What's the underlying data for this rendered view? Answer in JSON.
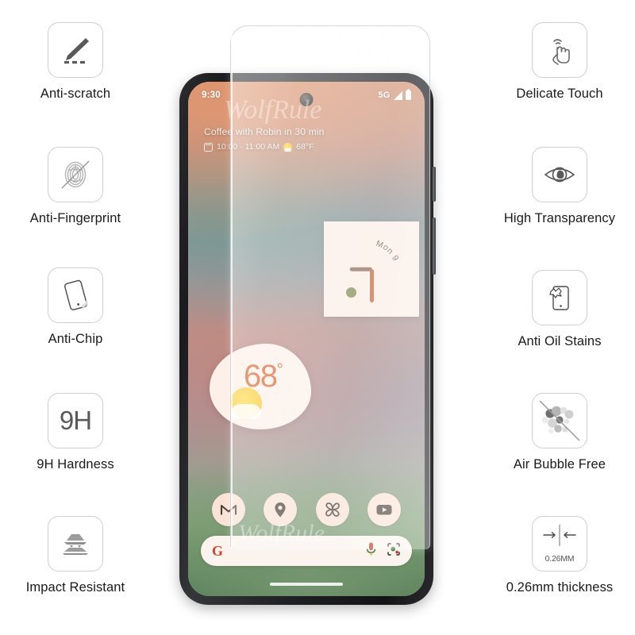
{
  "product": {
    "type": "tempered-glass-screen-protector",
    "watermark_text": "WolfRule"
  },
  "features_left": [
    {
      "label": "Anti-scratch",
      "icon": "knife-scratch-icon"
    },
    {
      "label": "Anti-Fingerprint",
      "icon": "fingerprint-crossed-icon"
    },
    {
      "label": "Anti-Chip",
      "icon": "tilted-phone-icon"
    },
    {
      "label": "9H Hardness",
      "icon": "hardness-9h-icon",
      "icon_text": "9H"
    },
    {
      "label": "Impact Resistant",
      "icon": "layered-plates-icon"
    }
  ],
  "features_right": [
    {
      "label": "Delicate Touch",
      "icon": "tapping-hand-icon"
    },
    {
      "label": "High Transparency",
      "icon": "eye-icon"
    },
    {
      "label": "Anti Oil Stains",
      "icon": "phone-oil-splash-icon"
    },
    {
      "label": "Air Bubble Free",
      "icon": "bubbles-crossed-icon"
    },
    {
      "label": "0.26mm thickness",
      "icon": "thickness-arrows-icon",
      "icon_text": "0.26MM"
    }
  ],
  "phone": {
    "status_bar": {
      "time": "9:30",
      "network": "5G",
      "signal_icon": "signal-bars-icon",
      "battery_icon": "battery-full-icon"
    },
    "at_a_glance": {
      "title": "Coffee with Robin in 30 min",
      "calendar_icon": "calendar-icon",
      "time_range": "10:00 - 11:00 AM",
      "weather_icon": "sun-behind-cloud-icon",
      "temperature": "68°F"
    },
    "clock_widget": {
      "date_label": "Mon 9",
      "icon": "analog-clock-widget"
    },
    "weather_widget": {
      "temperature": "68",
      "degree": "°",
      "icon": "sun-behind-cloud-icon"
    },
    "dock": [
      {
        "name": "Gmail",
        "icon": "gmail-icon"
      },
      {
        "name": "Maps",
        "icon": "map-pin-icon"
      },
      {
        "name": "Photos",
        "icon": "photos-pinwheel-icon"
      },
      {
        "name": "YouTube",
        "icon": "youtube-icon"
      }
    ],
    "search_bar": {
      "google_logo": "G",
      "mic_icon": "microphone-icon",
      "lens_icon": "google-lens-icon"
    },
    "home_indicator": "home-indicator-bar"
  },
  "colors": {
    "icon_stroke": "#5a5a5a",
    "icon_border": "#cfcfcf",
    "label_text": "#1a1a1a",
    "accent_orange": "#d9662f",
    "widget_cream": "#fbeee6",
    "dock_peach": "#fae3d6",
    "google_red": "#d4422a"
  }
}
